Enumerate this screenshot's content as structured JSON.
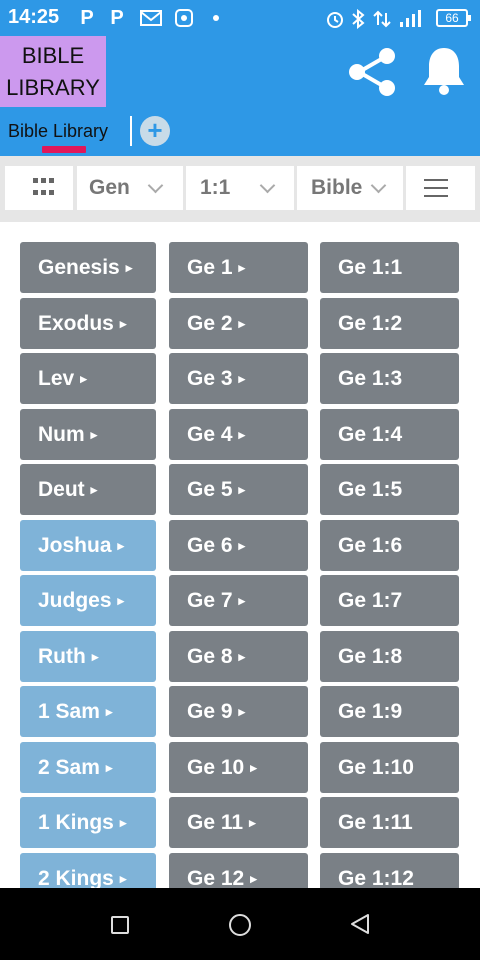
{
  "status_bar": {
    "time": "14:25",
    "battery": "66",
    "left_icons": [
      "p-app-icon",
      "p-app-icon",
      "gmail-icon",
      "app-icon",
      "dot-icon"
    ],
    "right_icons": [
      "alarm-icon",
      "bluetooth-icon",
      "data-transfer-icon",
      "signal-icon"
    ]
  },
  "header": {
    "logo_line1": "BIBLE",
    "logo_line2": "LIBRARY",
    "tab_label": "Bible Library",
    "add_tab": "+",
    "colors": {
      "bar": "#2e98e6",
      "logo_bg": "#cc99ee",
      "tab_indicator": "#e0185a"
    }
  },
  "toolbar": {
    "book": "Gen",
    "chapter_verse": "1:1",
    "version": "Bible"
  },
  "books": [
    {
      "label": "Genesis",
      "style": "gray"
    },
    {
      "label": "Exodus",
      "style": "gray"
    },
    {
      "label": "Lev",
      "style": "gray"
    },
    {
      "label": "Num",
      "style": "gray"
    },
    {
      "label": "Deut",
      "style": "gray"
    },
    {
      "label": "Joshua",
      "style": "blue"
    },
    {
      "label": "Judges",
      "style": "blue"
    },
    {
      "label": "Ruth",
      "style": "blue"
    },
    {
      "label": "1 Sam",
      "style": "blue"
    },
    {
      "label": "2 Sam",
      "style": "blue"
    },
    {
      "label": "1 Kings",
      "style": "blue"
    },
    {
      "label": "2 Kings",
      "style": "blue"
    }
  ],
  "chapters": [
    "Ge 1",
    "Ge 2",
    "Ge 3",
    "Ge 4",
    "Ge 5",
    "Ge 6",
    "Ge 7",
    "Ge 8",
    "Ge 9",
    "Ge 10",
    "Ge 11",
    "Ge 12"
  ],
  "verses": [
    "Ge 1:1",
    "Ge 1:2",
    "Ge 1:3",
    "Ge 1:4",
    "Ge 1:5",
    "Ge 1:6",
    "Ge 1:7",
    "Ge 1:8",
    "Ge 1:9",
    "Ge 1:10",
    "Ge 1:11",
    "Ge 1:12"
  ],
  "arrow_glyph": "▸",
  "tile_colors": {
    "gray": "#7a8086",
    "blue": "#7fb3d8"
  }
}
